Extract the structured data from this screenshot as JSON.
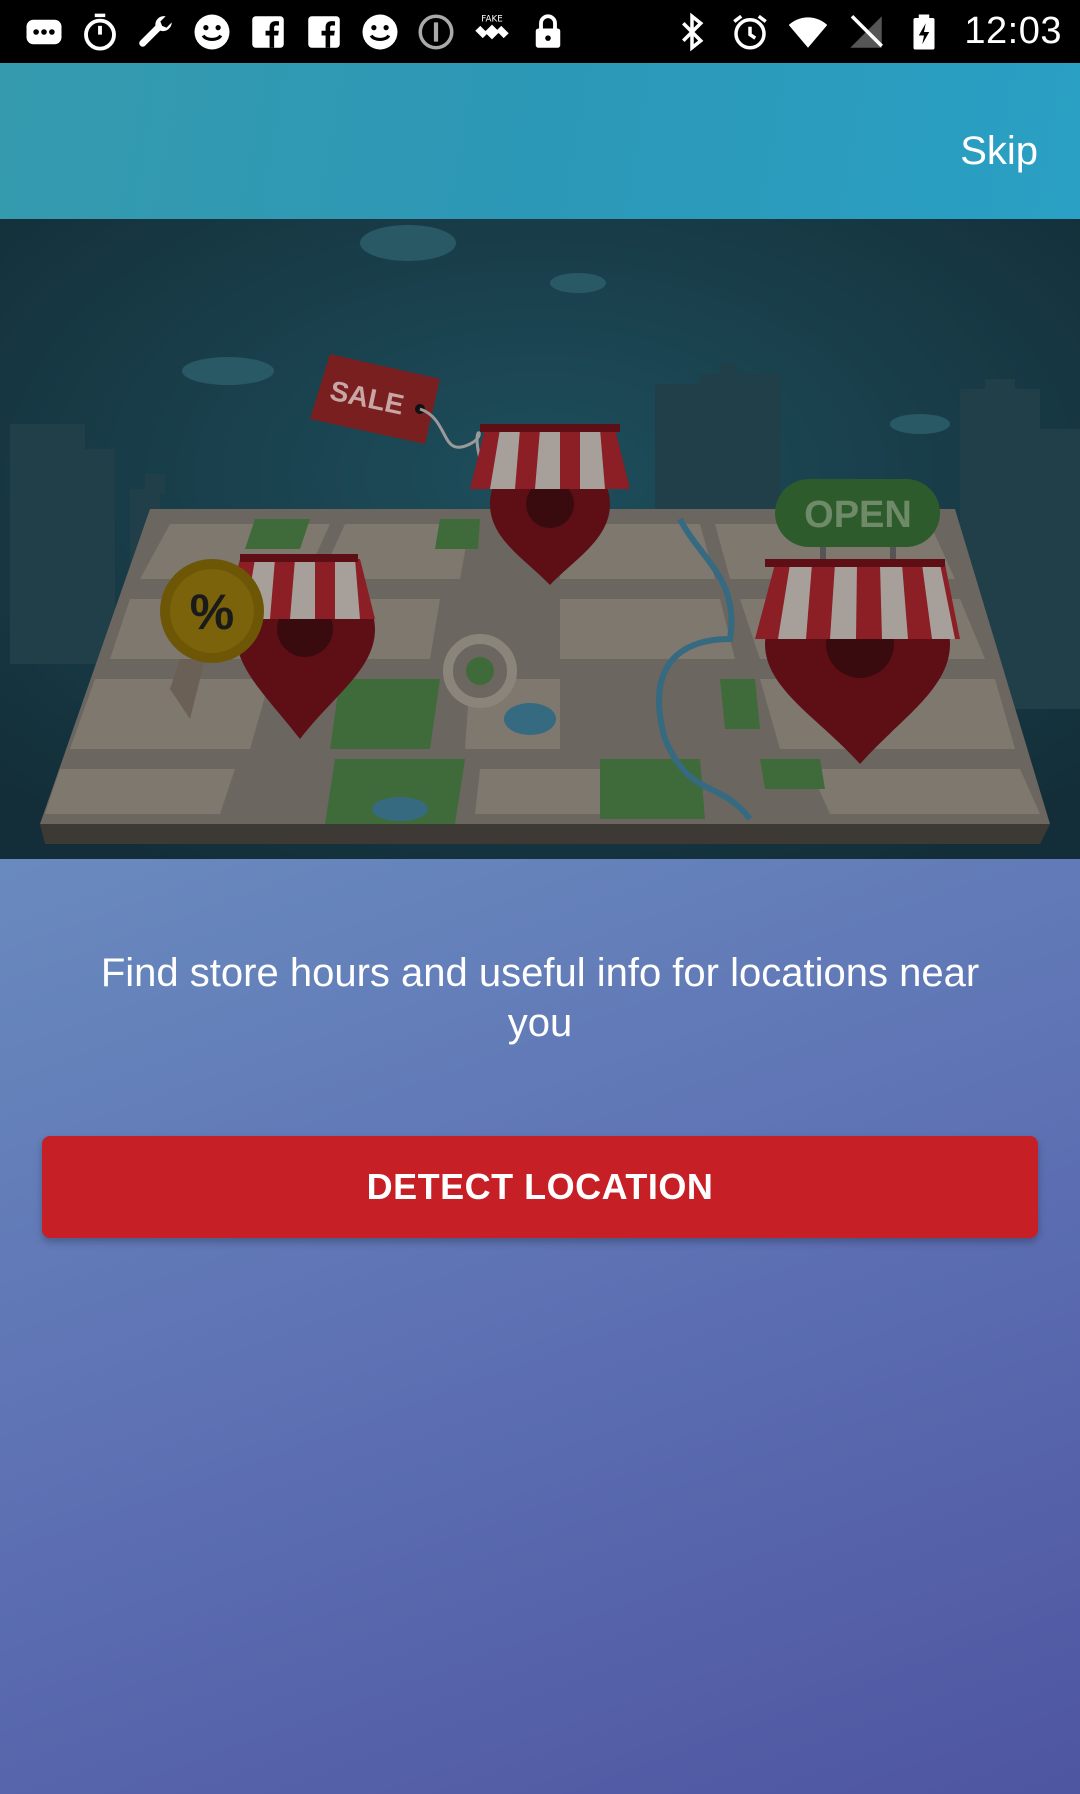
{
  "status_bar": {
    "time": "12:03",
    "left_icons": [
      "messages-icon",
      "stopwatch-icon",
      "wrench-icon",
      "smiley-icon",
      "facebook-icon",
      "facebook-icon",
      "smiley-icon",
      "info-circle-icon",
      "satellite-icon",
      "lock-icon"
    ],
    "right_icons": [
      "bluetooth-icon",
      "alarm-icon",
      "wifi-icon",
      "no-signal-icon",
      "battery-charging-icon"
    ]
  },
  "app_bar": {
    "skip_label": "Skip"
  },
  "hero": {
    "sale_tag": "SALE",
    "open_sign": "OPEN",
    "discount_badge": "%"
  },
  "main": {
    "tagline": "Find store hours and useful info for locations near you",
    "detect_button_label": "DETECT LOCATION"
  },
  "colors": {
    "app_bar": "#2c98b7",
    "button": "#c62026",
    "hero_bg": "#173c4a"
  }
}
